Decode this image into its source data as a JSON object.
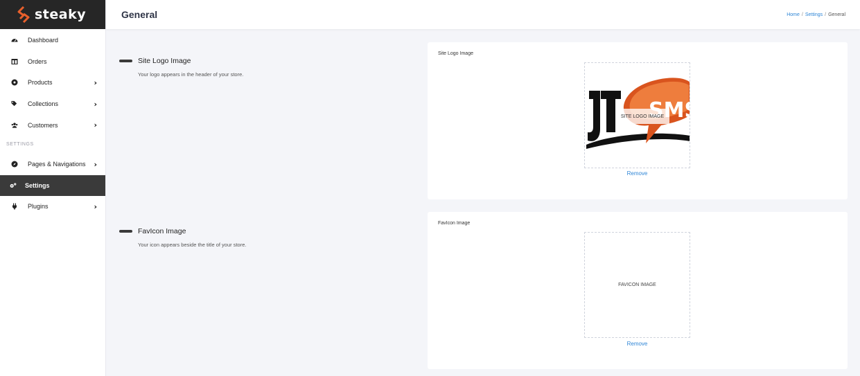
{
  "brand": {
    "name": "steaky",
    "accent": "#e8602c"
  },
  "sidebar": {
    "items": [
      {
        "label": "Dashboard",
        "icon": "dashboard-icon",
        "has_chevron": false
      },
      {
        "label": "Orders",
        "icon": "orders-icon",
        "has_chevron": false
      },
      {
        "label": "Products",
        "icon": "products-icon",
        "has_chevron": true
      },
      {
        "label": "Collections",
        "icon": "tags-icon",
        "has_chevron": true
      },
      {
        "label": "Customers",
        "icon": "users-icon",
        "has_chevron": true
      }
    ],
    "section_label": "SETTINGS",
    "settings_items": [
      {
        "label": "Pages & Navigations",
        "icon": "compass-icon",
        "has_chevron": true
      },
      {
        "label": "Settings",
        "icon": "cogs-icon",
        "has_chevron": false,
        "active": true
      },
      {
        "label": "Plugins",
        "icon": "plug-icon",
        "has_chevron": true
      }
    ]
  },
  "header": {
    "title": "General",
    "breadcrumb": [
      {
        "label": "Home",
        "link": true
      },
      {
        "label": "Settings",
        "link": true
      },
      {
        "label": "General",
        "link": false
      }
    ]
  },
  "logo_section": {
    "title": "Site Logo Image",
    "description": "Your logo appears in the header of your store.",
    "card_label": "Site Logo Image",
    "image_overlay_text": "SITE LOGO IMAGE",
    "remove_label": "Remove"
  },
  "favicon_section": {
    "title": "FavIcon Image",
    "description": "Your icon appears beside the title of your store.",
    "card_label": "FavIcon Image",
    "placeholder_text": "FAVICON IMAGE",
    "remove_label": "Remove"
  },
  "colors": {
    "link": "#2f86d6",
    "active_bg": "#3a3a3a",
    "sidebar_header_bg": "#262626"
  }
}
